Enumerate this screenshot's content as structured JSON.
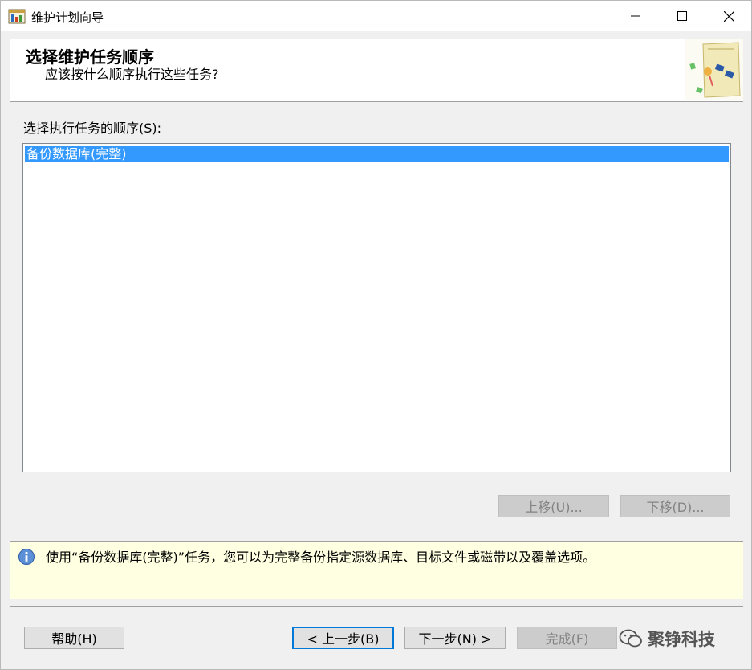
{
  "window": {
    "title": "维护计划向导"
  },
  "header": {
    "title": "选择维护任务顺序",
    "subtitle": "应该按什么顺序执行这些任务?"
  },
  "task_order": {
    "label": "选择执行任务的顺序(S):",
    "items": [
      {
        "label": "备份数据库(完整)",
        "selected": true
      }
    ],
    "move_up_label": "上移(U)...",
    "move_down_label": "下移(D)..."
  },
  "info": {
    "icon": "info-icon",
    "text": "使用“备份数据库(完整)”任务，您可以为完整备份指定源数据库、目标文件或磁带以及覆盖选项。"
  },
  "footer": {
    "help_label": "帮助(H)",
    "back_label": "< 上一步(B)",
    "next_label": "下一步(N) >",
    "finish_label": "完成(F)",
    "watermark": "聚铮科技"
  },
  "colors": {
    "selection": "#3399ff",
    "info_bg": "#ffffe1",
    "focus_border": "#0078d7"
  }
}
